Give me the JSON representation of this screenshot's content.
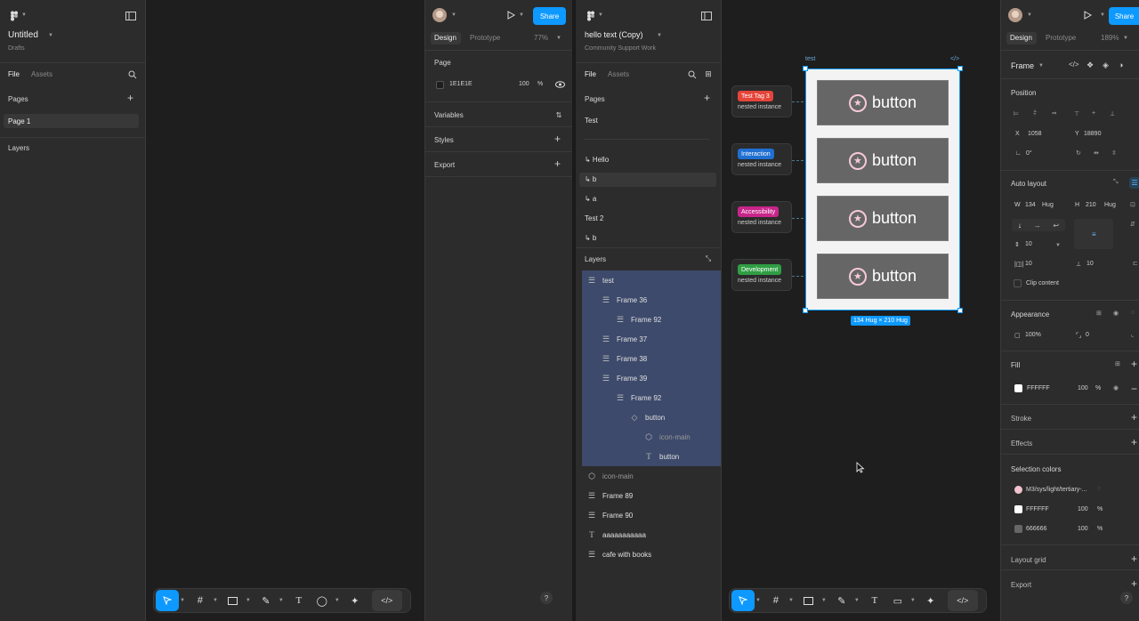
{
  "window1": {
    "file_title": "Untitled",
    "file_location": "Drafts",
    "tabs": [
      "File",
      "Assets"
    ],
    "pages_label": "Pages",
    "pages": [
      "Page 1"
    ],
    "layers_label": "Layers",
    "design_tab": "Design",
    "prototype_tab": "Prototype",
    "zoom": "77%",
    "share": "Share",
    "page_section": "Page",
    "page_color": "1E1E1E",
    "page_opacity": "100",
    "percent": "%",
    "variables": "Variables",
    "styles": "Styles",
    "export": "Export"
  },
  "window2": {
    "file_title": "hello text (Copy)",
    "file_location": "Community Support Work",
    "tabs": [
      "File",
      "Assets"
    ],
    "pages_label": "Pages",
    "pages": [
      "Test",
      "↳ Hello",
      "↳ b",
      "↳ a",
      "Test 2",
      "↳ b"
    ],
    "layers_label": "Layers",
    "layers": [
      {
        "name": "test",
        "indent": 0,
        "icon": "autolayout-icon",
        "selected": true
      },
      {
        "name": "Frame 36",
        "indent": 1,
        "icon": "autolayout-icon",
        "selected": true
      },
      {
        "name": "Frame 92",
        "indent": 2,
        "icon": "autolayout-icon",
        "selected": true
      },
      {
        "name": "Frame 37",
        "indent": 1,
        "icon": "autolayout-icon",
        "selected": true
      },
      {
        "name": "Frame 38",
        "indent": 1,
        "icon": "autolayout-icon",
        "selected": true
      },
      {
        "name": "Frame 39",
        "indent": 1,
        "icon": "autolayout-icon",
        "selected": true
      },
      {
        "name": "Frame 92",
        "indent": 2,
        "icon": "autolayout-icon",
        "selected": true
      },
      {
        "name": "button",
        "indent": 3,
        "icon": "instance-icon",
        "selected": true
      },
      {
        "name": "icon-main",
        "indent": 4,
        "icon": "component-icon",
        "selected": true
      },
      {
        "name": "button",
        "indent": 4,
        "icon": "text-icon",
        "selected": true
      },
      {
        "name": "icon-main",
        "indent": 0,
        "icon": "component-icon",
        "selected": false
      },
      {
        "name": "Frame 89",
        "indent": 0,
        "icon": "autolayout-icon",
        "selected": false
      },
      {
        "name": "Frame 90",
        "indent": 0,
        "icon": "autolayout-icon",
        "selected": false
      },
      {
        "name": "aaaaaaaaaaa",
        "indent": 0,
        "icon": "text-icon",
        "selected": false
      },
      {
        "name": "cafe with books",
        "indent": 0,
        "icon": "autolayout-icon",
        "selected": false
      }
    ],
    "canvas": {
      "frame_label": "test",
      "button_text": "button",
      "size_badge": "134 Hug × 210 Hug",
      "tags": [
        {
          "label": "Test Tag 3",
          "color": "#e5453a",
          "sub": "nested instance"
        },
        {
          "label": "Interaction",
          "color": "#1f6fd1",
          "sub": "nested instance"
        },
        {
          "label": "Accessibility",
          "color": "#c8258a",
          "sub": "nested instance"
        },
        {
          "label": "Development",
          "color": "#2f9e44",
          "sub": "nested instance"
        }
      ]
    },
    "design_tab": "Design",
    "prototype_tab": "Prototype",
    "zoom": "189%",
    "share": "Share",
    "frame_dropdown": "Frame",
    "position": "Position",
    "x_label": "X",
    "x_value": "1058",
    "y_label": "Y",
    "y_value": "18890",
    "rotation": "0°",
    "auto_layout": "Auto layout",
    "w_label": "W",
    "w_value": "134",
    "h_label": "H",
    "h_value": "210",
    "hug": "Hug",
    "gap": "10",
    "pad_h": "10",
    "pad_v": "10",
    "clip_content": "Clip content",
    "appearance": "Appearance",
    "opacity": "100%",
    "radius": "0",
    "fill": "Fill",
    "fill_hex": "FFFFFF",
    "fill_opacity": "100",
    "percent": "%",
    "stroke": "Stroke",
    "effects": "Effects",
    "selection_colors": "Selection colors",
    "sel_colors": [
      {
        "name": "M3/sys/light/tertiary-...",
        "swatch": "#f3c2cf",
        "opacity": ""
      },
      {
        "name": "FFFFFF",
        "swatch": "#ffffff",
        "opacity": "100"
      },
      {
        "name": "666666",
        "swatch": "#666666",
        "opacity": "100"
      }
    ],
    "layout_grid": "Layout grid",
    "export": "Export"
  },
  "colors": {
    "accent": "#0d99ff",
    "canvas": "#1e1e1e",
    "panel": "#2c2c2c",
    "selection": "#3d4a6b"
  }
}
